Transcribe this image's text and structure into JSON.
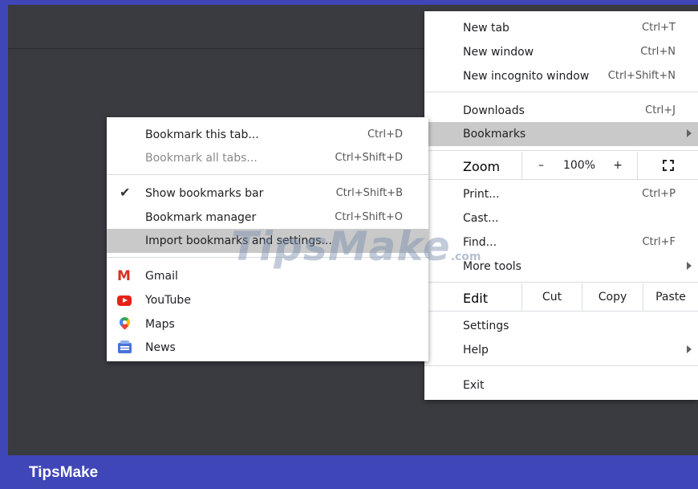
{
  "main_menu": {
    "new_tab": {
      "label": "New tab",
      "shortcut": "Ctrl+T"
    },
    "new_window": {
      "label": "New window",
      "shortcut": "Ctrl+N"
    },
    "new_incognito": {
      "label": "New incognito window",
      "shortcut": "Ctrl+Shift+N"
    },
    "downloads": {
      "label": "Downloads",
      "shortcut": "Ctrl+J"
    },
    "bookmarks": {
      "label": "Bookmarks"
    },
    "zoom": {
      "label": "Zoom",
      "minus": "–",
      "level": "100%",
      "plus": "+"
    },
    "print": {
      "label": "Print...",
      "shortcut": "Ctrl+P"
    },
    "cast": {
      "label": "Cast..."
    },
    "find": {
      "label": "Find...",
      "shortcut": "Ctrl+F"
    },
    "more_tools": {
      "label": "More tools"
    },
    "edit": {
      "label": "Edit",
      "cut": "Cut",
      "copy": "Copy",
      "paste": "Paste"
    },
    "settings": {
      "label": "Settings"
    },
    "help": {
      "label": "Help"
    },
    "exit": {
      "label": "Exit"
    }
  },
  "bookmarks_menu": {
    "bookmark_tab": {
      "label": "Bookmark this tab...",
      "shortcut": "Ctrl+D"
    },
    "bookmark_all": {
      "label": "Bookmark all tabs...",
      "shortcut": "Ctrl+Shift+D"
    },
    "show_bar": {
      "label": "Show bookmarks bar",
      "shortcut": "Ctrl+Shift+B",
      "check": "✔"
    },
    "manager": {
      "label": "Bookmark manager",
      "shortcut": "Ctrl+Shift+O"
    },
    "import": {
      "label": "Import bookmarks and settings..."
    },
    "items": [
      {
        "label": "Gmail",
        "icon": "gmail-icon"
      },
      {
        "label": "YouTube",
        "icon": "youtube-icon"
      },
      {
        "label": "Maps",
        "icon": "maps-icon"
      },
      {
        "label": "News",
        "icon": "news-icon"
      }
    ],
    "gmail_glyph": "M"
  },
  "watermark": {
    "text": "TipsMake",
    "suffix": ".com"
  },
  "footer": {
    "brand": "TipsMake"
  },
  "colors": {
    "border": "#3f46b8",
    "dark_bg": "#3a3b40",
    "hover": "#c9c9c9"
  }
}
